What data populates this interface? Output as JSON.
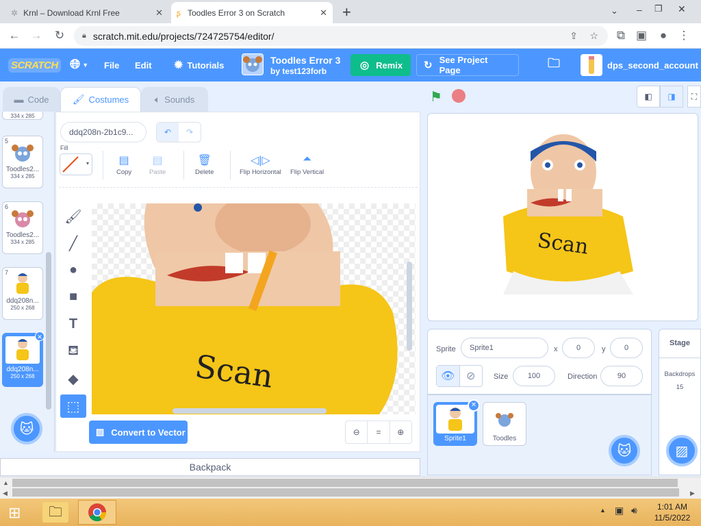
{
  "browser": {
    "tabs": [
      {
        "title": "Krnl – Download Krnl Free",
        "active": false
      },
      {
        "title": "Toodles Error 3 on Scratch",
        "active": true
      }
    ],
    "new_tab_symbol": "+",
    "url": "scratch.mit.edu/projects/724725754/editor/",
    "window_controls": [
      "⌄",
      "–",
      "❐",
      "✕"
    ]
  },
  "menubar": {
    "logo": "SCRATCH",
    "file": "File",
    "edit": "Edit",
    "tutorials": "Tutorials",
    "project_title": "Toodles Error 3",
    "project_author": "by test123forb",
    "remix": "Remix",
    "see_project_page": "See Project Page",
    "username": "dps_second_account",
    "colors": {
      "bar": "#4c97ff",
      "remix": "#0fbd8c"
    }
  },
  "editor_tabs": {
    "code": "Code",
    "costumes": "Costumes",
    "sounds": "Sounds"
  },
  "costumes": [
    {
      "num": "",
      "name": "",
      "size": "334 x 285"
    },
    {
      "num": "5",
      "name": "Toodles2...",
      "size": "334 x 285"
    },
    {
      "num": "6",
      "name": "Toodles2...",
      "size": "334 x 285"
    },
    {
      "num": "7",
      "name": "ddq208n...",
      "size": "250 x 268"
    },
    {
      "num": "8",
      "name": "ddq208n...",
      "size": "250 x 268",
      "selected": true
    }
  ],
  "paint": {
    "costume_name": "ddq208n-2b1c9...",
    "fill_label": "Fill",
    "copy": "Copy",
    "paste": "Paste",
    "delete": "Delete",
    "flip_h": "Flip Horizontal",
    "flip_v": "Flip Vertical",
    "convert": "Convert to Vector",
    "zoom_reset": "="
  },
  "backpack": "Backpack",
  "sprite": {
    "sprite_label": "Sprite",
    "name": "Sprite1",
    "x_label": "x",
    "x": "0",
    "y_label": "y",
    "y": "0",
    "size_label": "Size",
    "size": "100",
    "direction_label": "Direction",
    "direction": "90"
  },
  "sprites": [
    {
      "name": "Sprite1",
      "selected": true
    },
    {
      "name": "Toodles",
      "selected": false
    }
  ],
  "stage_panel": {
    "title": "Stage",
    "backdrops_label": "Backdrops",
    "backdrops_count": "15"
  },
  "taskbar": {
    "time": "1:01 AM",
    "date": "11/5/2022"
  }
}
